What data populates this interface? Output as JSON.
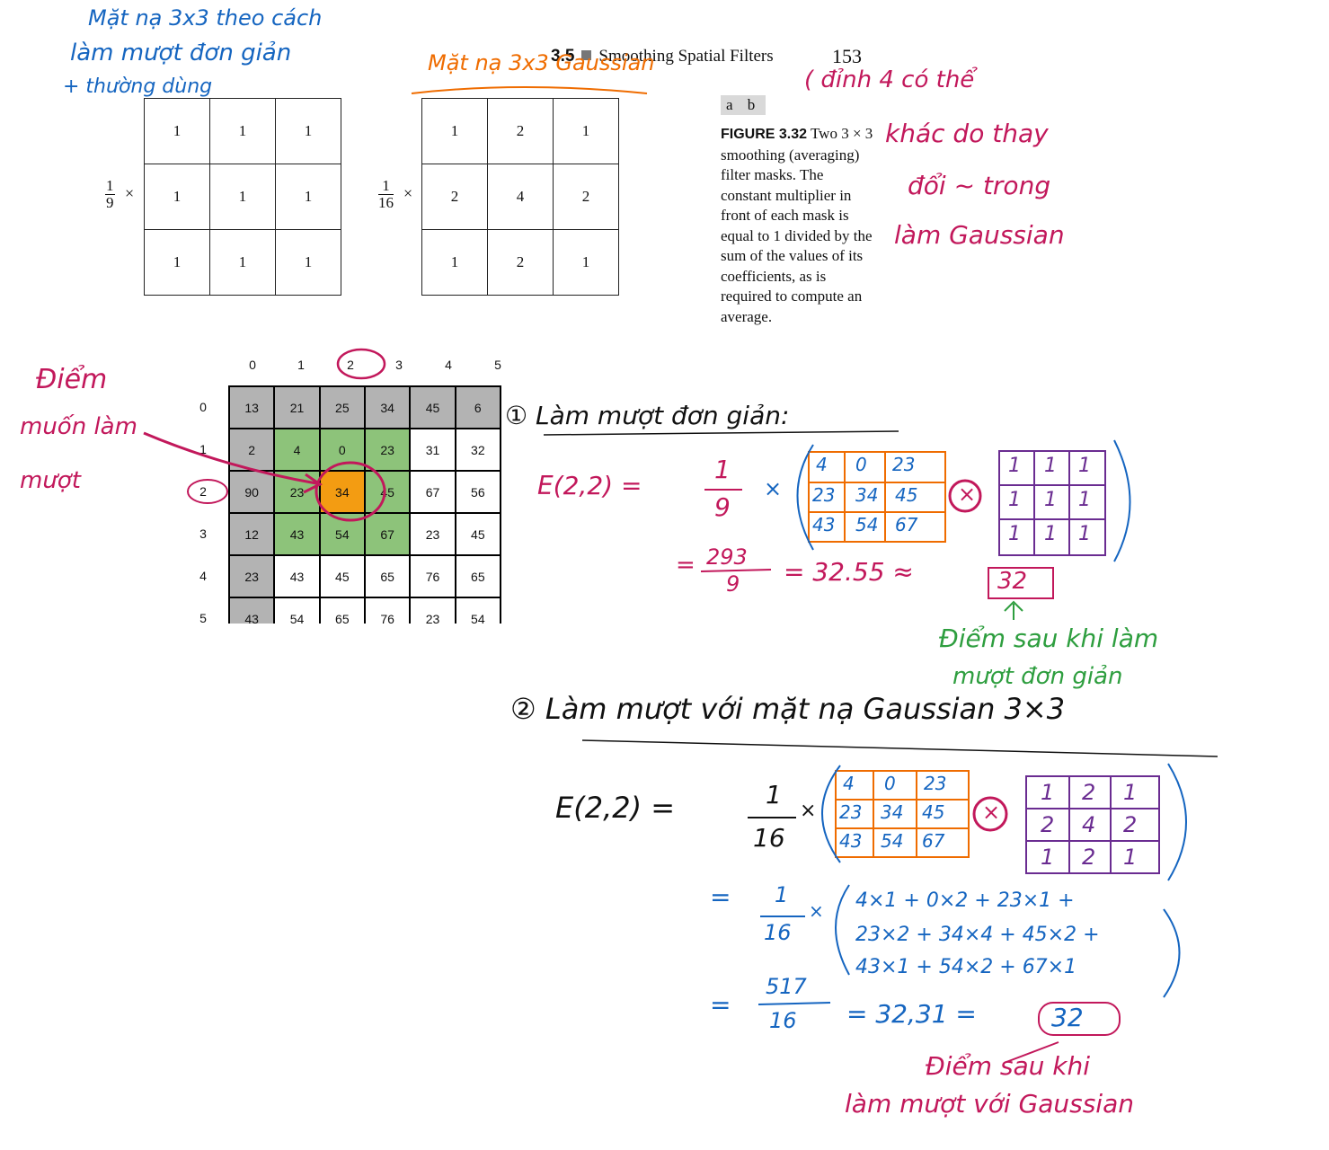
{
  "header": {
    "section": "3.5",
    "title": "Smoothing Spatial Filters",
    "page_number": "153"
  },
  "mask_a": {
    "multiplier_num": "1",
    "multiplier_den": "9",
    "times": "×",
    "cells": [
      [
        "1",
        "1",
        "1"
      ],
      [
        "1",
        "1",
        "1"
      ],
      [
        "1",
        "1",
        "1"
      ]
    ]
  },
  "mask_b": {
    "multiplier_num": "1",
    "multiplier_den": "16",
    "times": "×",
    "cells": [
      [
        "1",
        "2",
        "1"
      ],
      [
        "2",
        "4",
        "2"
      ],
      [
        "1",
        "2",
        "1"
      ]
    ]
  },
  "figure": {
    "panel_labels": "a b",
    "label": "FIGURE 3.32",
    "caption": "Two 3 × 3 smoothing (averaging) filter masks. The constant multiplier in front of each mask is equal to 1 divided by the sum of the values of its coefficients, as is required to compute an average."
  },
  "pixel_grid": {
    "col_headers": [
      "0",
      "1",
      "2",
      "3",
      "4",
      "5"
    ],
    "row_headers": [
      "0",
      "1",
      "2",
      "3",
      "4",
      "5"
    ],
    "rows": [
      [
        "13",
        "21",
        "25",
        "34",
        "45",
        "6"
      ],
      [
        "2",
        "4",
        "0",
        "23",
        "31",
        "32"
      ],
      [
        "90",
        "23",
        "34",
        "45",
        "67",
        "56"
      ],
      [
        "12",
        "43",
        "54",
        "67",
        "23",
        "45"
      ],
      [
        "23",
        "43",
        "45",
        "65",
        "76",
        "65"
      ],
      [
        "43",
        "54",
        "65",
        "76",
        "23",
        "54"
      ]
    ],
    "highlight_colors": {
      "gray": "#b3b3b3",
      "green": "#8dc37a",
      "orange": "#f39c12"
    }
  },
  "annotations": {
    "blue_top": [
      "Mặt nạ 3x3 theo cách",
      "làm mượt đơn giản",
      "+ thường dùng"
    ],
    "orange_top": "Mặt nạ 3x3 Gaussian",
    "magenta_right": [
      "( đỉnh 4 có thể",
      "khác do thay",
      "đổi ~ trong",
      "làm Gaussian"
    ],
    "magenta_left": [
      "Điểm",
      "muốn làm",
      "mượt"
    ],
    "step1_title": "① Làm mượt đơn giản:",
    "step1_lhs": "Ε(2,2) =",
    "step1_frac": {
      "num": "1",
      "den": "9"
    },
    "step1_times": "×",
    "step1_patch": [
      [
        "4",
        "0",
        "23"
      ],
      [
        "23",
        "34",
        "45"
      ],
      [
        "43",
        "54",
        "67"
      ]
    ],
    "step1_kernel": [
      [
        "1",
        "1",
        "1"
      ],
      [
        "1",
        "1",
        "1"
      ],
      [
        "1",
        "1",
        "1"
      ]
    ],
    "step1_result_frac": {
      "num": "293",
      "den": "9"
    },
    "step1_result": "= 32.55 ≈",
    "step1_result_eq": "=",
    "step1_boxed": "32",
    "step1_note": [
      "Điểm sau khi làm",
      "mượt đơn giản"
    ],
    "step2_title": "② Làm mượt với mặt nạ Gaussian 3×3",
    "step2_lhs": "Ε(2,2) =",
    "step2_frac": {
      "num": "1",
      "den": "16"
    },
    "step2_times": "×",
    "step2_patch": [
      [
        "4",
        "0",
        "23"
      ],
      [
        "23",
        "34",
        "45"
      ],
      [
        "43",
        "54",
        "67"
      ]
    ],
    "step2_kernel": [
      [
        "1",
        "2",
        "1"
      ],
      [
        "2",
        "4",
        "2"
      ],
      [
        "1",
        "2",
        "1"
      ]
    ],
    "step2_expand_frac": {
      "num": "1",
      "den": "16"
    },
    "step2_expand": [
      "4×1 + 0×2 + 23×1 +",
      "23×2 + 34×4 + 45×2 +",
      "43×1 + 54×2 + 67×1"
    ],
    "step2_result_frac": {
      "num": "517",
      "den": "16"
    },
    "step2_result": "= 32,31 =",
    "step2_boxed": "32",
    "step2_note": [
      "Điểm sau khi",
      "làm mượt với Gaussian"
    ],
    "circle_symbol": "×",
    "eq": "="
  },
  "colors": {
    "blue": "#1565c0",
    "magenta": "#c2185b",
    "orange": "#ef6c00",
    "green": "#2e9e3f",
    "purple": "#6a2c91",
    "black": "#111111"
  }
}
